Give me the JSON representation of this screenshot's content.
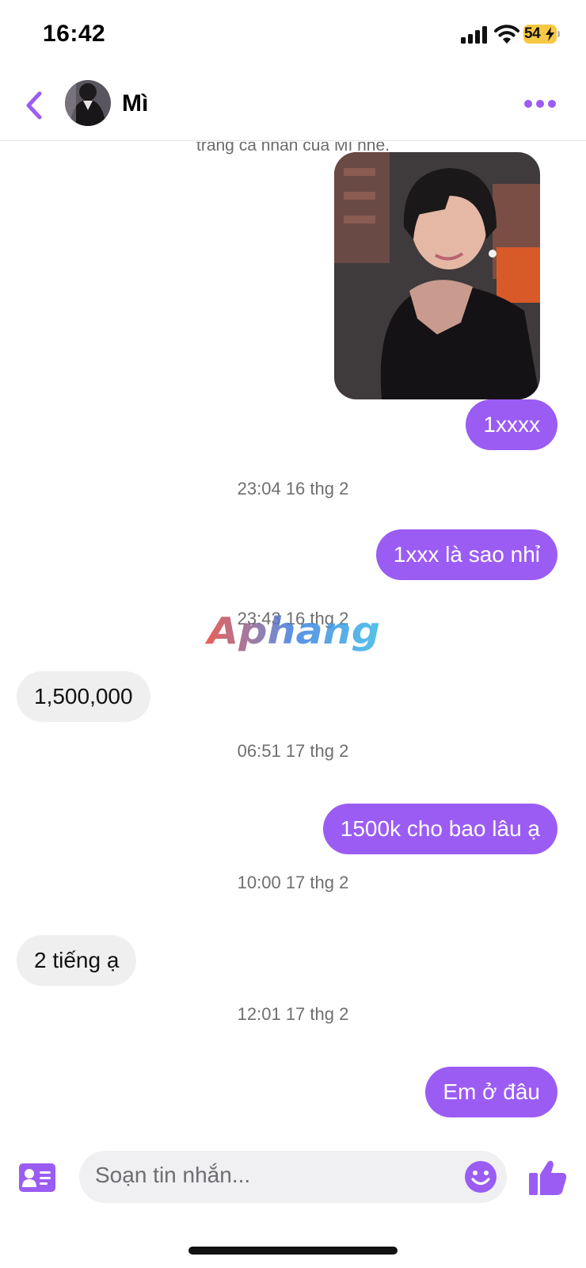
{
  "status_bar": {
    "time": "16:42",
    "battery": "54"
  },
  "header": {
    "contact_name": "Mì"
  },
  "messages": {
    "cut_off_text": "trang cá nhân của Mì nhé.",
    "items": [
      {
        "direction": "out",
        "text": "1xxxx"
      },
      {
        "type": "timestamp",
        "text": "23:04 16 thg 2"
      },
      {
        "direction": "out",
        "text": "1xxx là sao nhỉ"
      },
      {
        "type": "timestamp",
        "text": "23:43 16 thg 2"
      },
      {
        "direction": "in",
        "text": "1,500,000"
      },
      {
        "type": "timestamp",
        "text": "06:51 17 thg 2"
      },
      {
        "direction": "out",
        "text": "1500k cho bao lâu ạ"
      },
      {
        "type": "timestamp",
        "text": "10:00 17 thg 2"
      },
      {
        "direction": "in",
        "text": "2 tiếng ạ"
      },
      {
        "type": "timestamp",
        "text": "12:01 17 thg 2"
      },
      {
        "direction": "out",
        "text": "Em ở đâu"
      }
    ]
  },
  "watermark": "Aphang",
  "composer": {
    "placeholder": "Soạn tin nhắn..."
  },
  "icons": [
    "back-chevron-icon",
    "more-dots-icon",
    "contact-card-icon",
    "emoji-icon",
    "thumbs-up-icon"
  ],
  "colors": {
    "accent": "#9b5cf4",
    "incoming_bubble": "#efefef",
    "battery": "#f7c843"
  }
}
